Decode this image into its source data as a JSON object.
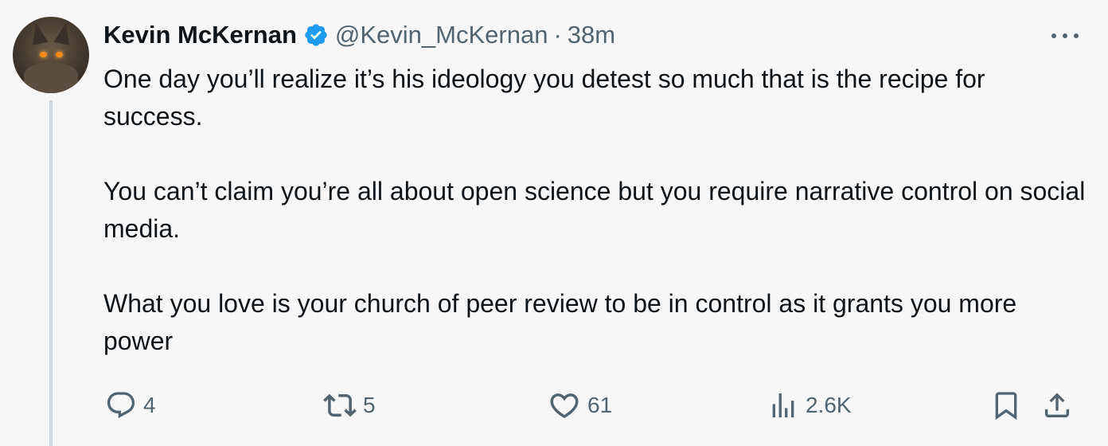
{
  "tweet": {
    "author_name": "Kevin McKernan",
    "verified": true,
    "handle": "@Kevin_McKernan",
    "separator": "·",
    "time": "38m",
    "paragraphs": [
      "One day you’ll realize it’s his ideology you detest so much that is the recipe for success.",
      "You can’t claim you’re all about open science but you require narrative control on social media.",
      "What you love is your church of peer review to be in control as it grants you more power"
    ]
  },
  "actions": {
    "replies": "4",
    "reposts": "5",
    "likes": "61",
    "views": "2.6K"
  },
  "colors": {
    "background": "#f7f7f7",
    "text": "#0f1419",
    "muted": "#536471",
    "verified": "#1d9bf0",
    "thread_line": "#cfd9de"
  },
  "icons": [
    "verified-badge-icon",
    "more-icon",
    "reply-icon",
    "repost-icon",
    "like-icon",
    "views-icon",
    "bookmark-icon",
    "share-icon"
  ]
}
